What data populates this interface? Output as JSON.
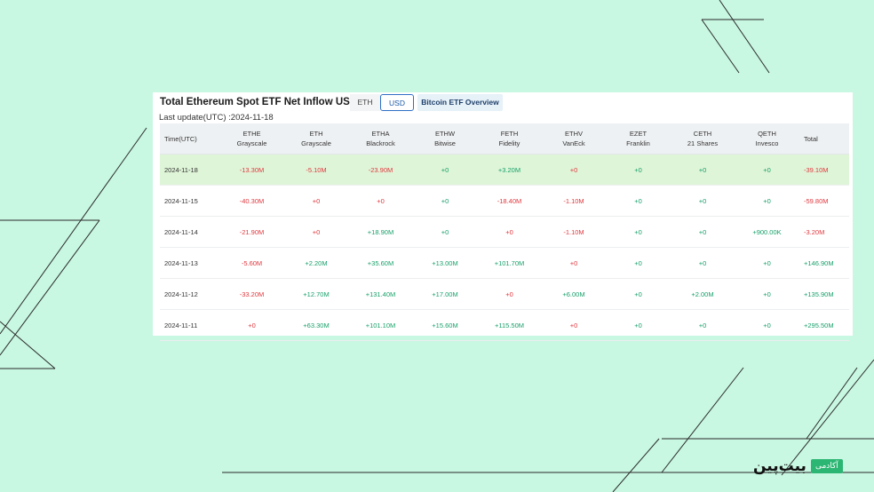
{
  "panel": {
    "title": "Total Ethereum Spot ETF Net Inflow USD",
    "last_update": "Last update(UTC) :2024-11-18",
    "tabs": {
      "eth": "ETH",
      "usd": "USD",
      "btc": "Bitcoin ETF Overview"
    }
  },
  "table": {
    "time_header": "Time(UTC)",
    "total_header": "Total",
    "funds": [
      {
        "ticker": "ETHE",
        "issuer": "Grayscale"
      },
      {
        "ticker": "ETH",
        "issuer": "Grayscale"
      },
      {
        "ticker": "ETHA",
        "issuer": "Blackrock"
      },
      {
        "ticker": "ETHW",
        "issuer": "Bitwise"
      },
      {
        "ticker": "FETH",
        "issuer": "Fidelity"
      },
      {
        "ticker": "ETHV",
        "issuer": "VanEck"
      },
      {
        "ticker": "EZET",
        "issuer": "Franklin"
      },
      {
        "ticker": "CETH",
        "issuer": "21 Shares"
      },
      {
        "ticker": "QETH",
        "issuer": "Invesco"
      }
    ],
    "rows": [
      {
        "date": "2024-11-18",
        "values": [
          "-13.30M",
          "-5.10M",
          "-23.90M",
          "+0",
          "+3.20M",
          "+0",
          "+0",
          "+0",
          "+0"
        ],
        "total": "-39.10M"
      },
      {
        "date": "2024-11-15",
        "values": [
          "-40.30M",
          "+0",
          "+0",
          "+0",
          "-18.40M",
          "-1.10M",
          "+0",
          "+0",
          "+0"
        ],
        "total": "-59.80M"
      },
      {
        "date": "2024-11-14",
        "values": [
          "-21.90M",
          "+0",
          "+18.90M",
          "+0",
          "+0",
          "-1.10M",
          "+0",
          "+0",
          "+900.00K"
        ],
        "total": "-3.20M"
      },
      {
        "date": "2024-11-13",
        "values": [
          "-5.60M",
          "+2.20M",
          "+35.60M",
          "+13.00M",
          "+101.70M",
          "+0",
          "+0",
          "+0",
          "+0"
        ],
        "total": "+146.90M"
      },
      {
        "date": "2024-11-12",
        "values": [
          "-33.20M",
          "+12.70M",
          "+131.40M",
          "+17.00M",
          "+0",
          "+6.00M",
          "+0",
          "+2.00M",
          "+0"
        ],
        "total": "+135.90M"
      },
      {
        "date": "2024-11-11",
        "values": [
          "+0",
          "+63.30M",
          "+101.10M",
          "+15.60M",
          "+115.50M",
          "+0",
          "+0",
          "+0",
          "+0"
        ],
        "total": "+295.50M"
      }
    ]
  },
  "logo": {
    "word": "بیت‌پین",
    "badge": "آکادمی"
  },
  "colors": {
    "background": "#c8f7e2",
    "negative": "#e0383e",
    "positive": "#17a06a",
    "highlight": "#dff5d8"
  }
}
